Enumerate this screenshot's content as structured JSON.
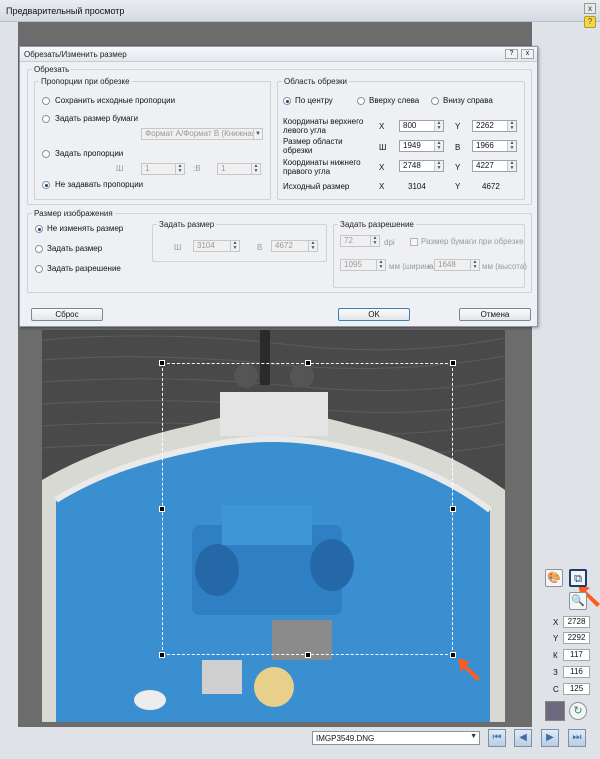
{
  "window": {
    "title": "Предварительный просмотр",
    "close_glyph": "x",
    "help_glyph": "?"
  },
  "dialog": {
    "title": "Обрезать/Изменить размер",
    "help_glyph": "?",
    "close_glyph": "x",
    "crop_section": "Обрезать",
    "proportions": {
      "legend": "Пропорции при обрезке",
      "keep_original": "Сохранить исходные пропорции",
      "paper_size": "Задать размер бумаги",
      "paper_select": "Формат A/Формат B (Книжная)",
      "set_proportions": "Задать пропорции",
      "w_symbol": "Ш",
      "w_value": "1",
      "colon_symbol": ":В",
      "h_value": "1",
      "no_proportions": "Не задавать пропорции"
    },
    "crop_area": {
      "legend": "Область обрезки",
      "center": "По центру",
      "top_left": "Вверху слева",
      "bottom_right": "Внизу справа",
      "top_left_coords_label": "Координаты верхнего левого угла",
      "area_size_label": "Размер области обрезки",
      "bottom_right_coords_label": "Координаты нижнего правого угла",
      "source_size_label": "Исходный размер",
      "x_symbol": "X",
      "y_symbol": "Y",
      "w_symbol": "Ш",
      "h_symbol": "В",
      "x1": "800",
      "y1": "2262",
      "w": "1949",
      "h": "1966",
      "x2": "2748",
      "y2": "4227",
      "src_x": "3104",
      "src_y": "4672"
    },
    "image_size": {
      "legend": "Размер изображения",
      "keep_size": "Не изменять размер",
      "set_size": "Задать размер",
      "set_resolution": "Задать разрешение"
    },
    "set_size": {
      "legend": "Задать размер",
      "w_symbol": "Ш",
      "w_value": "3104",
      "h_symbol": "В",
      "h_value": "4672"
    },
    "set_resolution": {
      "legend": "Задать разрешение",
      "dpi_value": "72",
      "dpi_unit": "dpi",
      "paper_check": "Размер бумаги при обрезке",
      "width_mm": "1095",
      "width_unit": "мм (ширина)",
      "times": "x",
      "height_mm": "1648",
      "height_unit": "мм (высота)"
    },
    "buttons": {
      "reset": "Сброс",
      "ok": "OK",
      "cancel": "Отмена"
    }
  },
  "side_panel": {
    "coords": [
      {
        "label": "X",
        "value": "2728"
      },
      {
        "label": "Y",
        "value": "2292"
      },
      {
        "label": "К",
        "value": "117"
      },
      {
        "label": "З",
        "value": "116"
      },
      {
        "label": "С",
        "value": "125"
      }
    ],
    "swatch_color": "#6e6a7e"
  },
  "bottom_bar": {
    "file_select": "IMGP3549.DNG"
  },
  "colors": {
    "arrow": "#ff5a1f",
    "deck_blue": "#3a8fd0",
    "sea": "#4b4a4a"
  },
  "icons": [
    "close-icon",
    "help-icon",
    "palette-icon",
    "crop-icon",
    "zoom-icon",
    "refresh-icon",
    "first-icon",
    "prev-icon",
    "next-icon",
    "last-icon",
    "chevron-down-icon"
  ]
}
